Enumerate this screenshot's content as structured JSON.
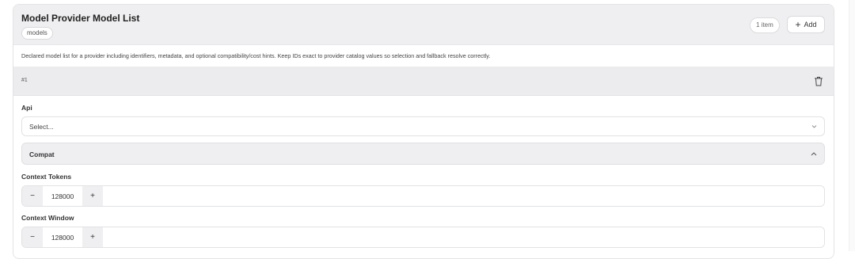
{
  "panel": {
    "title": "Model Provider Model List",
    "tag": "models",
    "count": "1 item",
    "add_label": "Add",
    "description": "Declared model list for a provider including identifiers, metadata, and optional compatibility/cost hints. Keep IDs exact to provider catalog values so selection and fallback resolve correctly."
  },
  "item": {
    "index": "#1",
    "api": {
      "label": "Api",
      "placeholder": "Select..."
    },
    "compat": {
      "label": "Compat"
    },
    "context_tokens": {
      "label": "Context Tokens",
      "value": "128000"
    },
    "context_window": {
      "label": "Context Window",
      "value": "128000"
    }
  },
  "stepper": {
    "decrement": "−",
    "increment": "+"
  }
}
